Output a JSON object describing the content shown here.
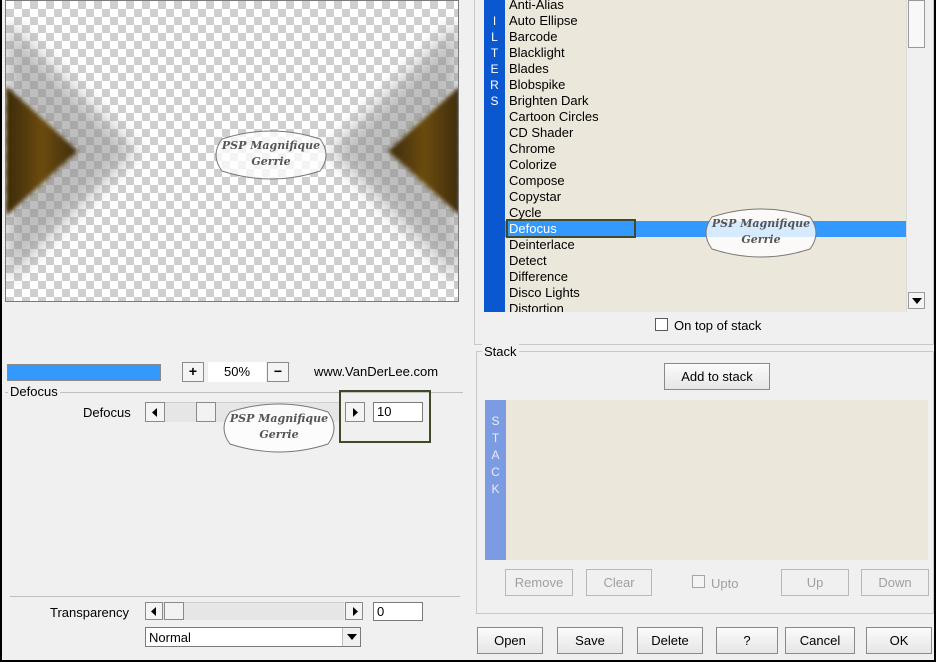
{
  "preview": {
    "watermark": {
      "line1": "PSP Magnifique",
      "line2": "Gerrie"
    }
  },
  "progress": {
    "fraction": 1.0
  },
  "zoom": {
    "plus_label": "+",
    "value": "50%",
    "minus_label": "−"
  },
  "website": "www.VanDerLee.com",
  "defocus_group": {
    "title": "Defocus",
    "param_label": "Defocus",
    "value": "10"
  },
  "transparency": {
    "label": "Transparency",
    "value": "0"
  },
  "blend_mode": {
    "selected": "Normal"
  },
  "filters": {
    "sidebar_letters": [
      "I",
      "L",
      "T",
      "E",
      "R",
      "S"
    ],
    "items": [
      "Anti-Alias",
      "Auto Ellipse",
      "Barcode",
      "Blacklight",
      "Blades",
      "Blobspike",
      "Brighten Dark",
      "Cartoon Circles",
      "CD Shader",
      "Chrome",
      "Colorize",
      "Compose",
      "Copystar",
      "Cycle",
      "Defocus",
      "Deinterlace",
      "Detect",
      "Difference",
      "Disco Lights",
      "Distortion"
    ],
    "selected": "Defocus",
    "on_top_label": "On top of stack"
  },
  "stack": {
    "title": "Stack",
    "add_label": "Add to stack",
    "sidebar_letters": [
      "S",
      "T",
      "A",
      "C",
      "K"
    ],
    "remove_label": "Remove",
    "clear_label": "Clear",
    "upto_label": "Upto",
    "up_label": "Up",
    "down_label": "Down"
  },
  "footer": {
    "open": "Open",
    "save": "Save",
    "delete": "Delete",
    "help": "?",
    "cancel": "Cancel",
    "ok": "OK"
  },
  "colors": {
    "selection": "#3399ff",
    "filters_bar": "#0b57d0",
    "stack_bar": "#7b9be2",
    "list_bg": "#ebe7da",
    "highlight_box": "#3f4a2a",
    "preview_shape": "#5a3f0a"
  }
}
